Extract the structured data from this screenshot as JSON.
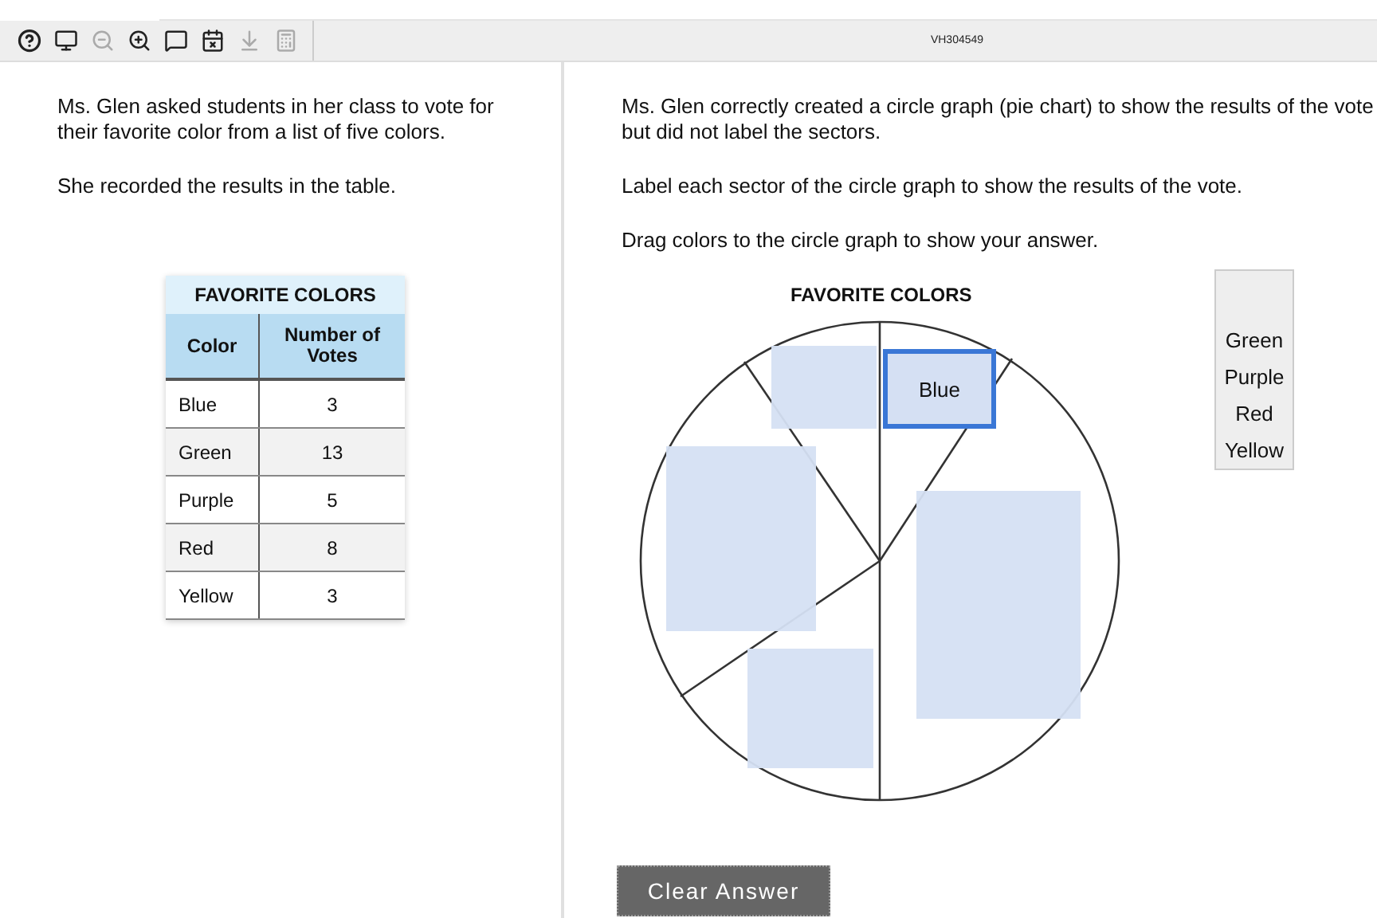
{
  "toolbar": {
    "tools": [
      {
        "kind": "help",
        "disabled": false
      },
      {
        "kind": "monitor",
        "disabled": false
      },
      {
        "kind": "zoom-out",
        "disabled": true
      },
      {
        "kind": "zoom-in",
        "disabled": false
      },
      {
        "kind": "speech",
        "disabled": false
      },
      {
        "kind": "notepad",
        "disabled": false
      },
      {
        "kind": "line-reader",
        "disabled": true
      },
      {
        "kind": "calculator",
        "disabled": true
      }
    ],
    "item_code": "VH304549"
  },
  "left": {
    "paragraphs": [
      "Ms. Glen asked students in her class to vote for their favorite color from a list of five colors.",
      "She recorded the results in the table."
    ],
    "table": {
      "title": "FAVORITE COLORS",
      "columns": [
        "Color",
        "Number of Votes"
      ],
      "rows": [
        {
          "name": "Blue",
          "votes": "3"
        },
        {
          "name": "Green",
          "votes": "13"
        },
        {
          "name": "Purple",
          "votes": "5"
        },
        {
          "name": "Red",
          "votes": "8"
        },
        {
          "name": "Yellow",
          "votes": "3"
        }
      ]
    }
  },
  "right": {
    "paragraphs": [
      "Ms. Glen correctly created a circle graph (pie chart) to show the results of the vote but did not label the sectors.",
      "Label each sector of the circle graph to show the results of the vote.",
      "Drag colors to the circle graph to show your answer."
    ],
    "graph": {
      "title": "FAVORITE COLORS",
      "zones": [
        {
          "kind": "empty",
          "selected": false
        },
        {
          "kind": "filled",
          "label": "Blue",
          "selected": true
        },
        {
          "kind": "empty",
          "selected": false
        },
        {
          "kind": "empty",
          "selected": false
        },
        {
          "kind": "empty",
          "selected": false
        }
      ]
    },
    "choices": [
      "Green",
      "Purple",
      "Red",
      "Yellow"
    ],
    "clear_button": "Clear Answer"
  }
}
